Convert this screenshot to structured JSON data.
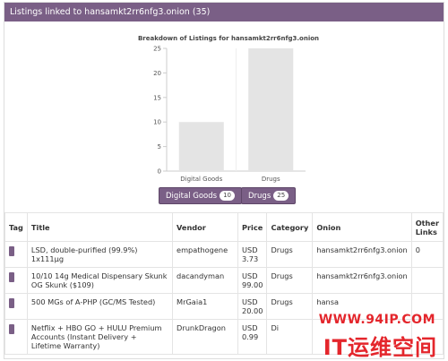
{
  "panel": {
    "title": "Listings linked to hansamkt2rr6nfg3.onion (35)"
  },
  "chart_data": {
    "type": "bar",
    "title": "Breakdown of Listings for hansamkt2rr6nfg3.onion",
    "categories": [
      "Digital Goods",
      "Drugs"
    ],
    "values": [
      10,
      25
    ],
    "ylim": [
      0,
      25
    ],
    "yticks": [
      0,
      5,
      10,
      15,
      20,
      25
    ],
    "grid": false,
    "bar_color": "#e4e4e4"
  },
  "filters": [
    {
      "label": "Digital Goods",
      "count": "10"
    },
    {
      "label": "Drugs",
      "count": "25"
    }
  ],
  "table": {
    "headers": [
      "Tag",
      "Title",
      "Vendor",
      "Price",
      "Category",
      "Onion",
      "Other Links"
    ],
    "rows": [
      {
        "title": "LSD, double-purified (99.9%) 1x111µg",
        "vendor": "empathogene",
        "price": "USD 3.73",
        "category": "Drugs",
        "onion": "hansamkt2rr6nfg3.onion",
        "other": "0"
      },
      {
        "title": "10/10 14g Medical Dispensary Skunk OG Skunk ($109)",
        "vendor": "dacandyman",
        "price": "USD 99.00",
        "category": "Drugs",
        "onion": "hansamkt2rr6nfg3.onion",
        "other": ""
      },
      {
        "title": "500 MGs of A-PHP (GC/MS Tested)",
        "vendor": "MrGaia1",
        "price": "USD 20.00",
        "category": "Drugs",
        "onion": "hansa",
        "other": ""
      },
      {
        "title": "Netflix + HBO GO + HULU Premium Accounts (Instant Delivery + Lifetime Warranty)",
        "vendor": "DrunkDragon",
        "price": "USD 0.99",
        "category": "Di",
        "onion": "",
        "other": ""
      }
    ]
  },
  "watermark": {
    "url": "WWW.94IP.COM",
    "text": "IT运维空间"
  },
  "colors": {
    "accent": "#7a5f86",
    "watermark": "#e4262c"
  }
}
